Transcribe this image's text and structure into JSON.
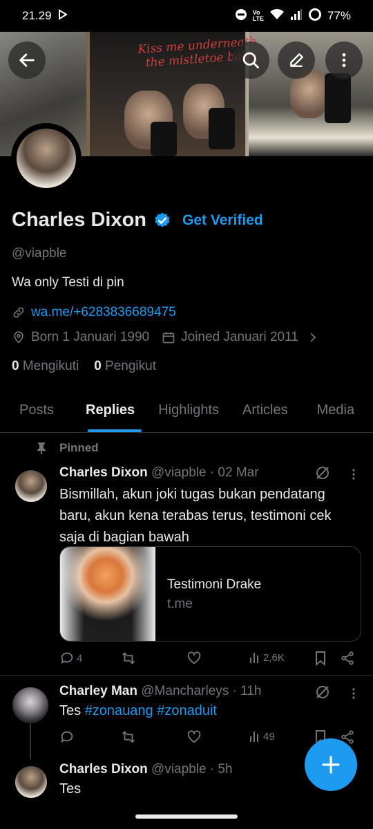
{
  "status_bar": {
    "time": "21.29",
    "battery": "77%"
  },
  "banner": {
    "script_line1": "Kiss me underneath",
    "script_line2": "the mistletoe baby"
  },
  "profile": {
    "name": "Charles Dixon",
    "get_verified": "Get Verified",
    "handle": "@viapble",
    "bio": "Wa only Testi di pin",
    "link": "wa.me/+6283836689475",
    "born": "Born 1 Januari 1990",
    "joined": "Joined Januari 2011",
    "following_count": "0",
    "following_label": "Mengikuti",
    "followers_count": "0",
    "followers_label": "Pengikut"
  },
  "tabs": [
    "Posts",
    "Replies",
    "Highlights",
    "Articles",
    "Media"
  ],
  "colors": {
    "accent": "#1d9bf0",
    "background": "#000000",
    "muted": "#71767b"
  },
  "tweets": [
    {
      "pinned_label": "Pinned",
      "name": "Charles Dixon",
      "meta": "@viapble · 02 Mar",
      "text": "Bismillah, akun joki tugas bukan pendatang baru, akun kena terabas terus, testimoni cek saja di bagian bawah",
      "card": {
        "title": "Testimoni Drake",
        "domain": "t.me"
      },
      "replies": "4",
      "views": "2,6K"
    },
    {
      "name": "Charley Man",
      "meta": "@Mancharleys · 11h",
      "text_prefix": "Tes ",
      "tag1": "#zonauang",
      "tag2": "#zonaduit",
      "views": "49"
    },
    {
      "name": "Charles Dixon",
      "meta": "@viapble · 5h",
      "text": "Tes"
    }
  ]
}
